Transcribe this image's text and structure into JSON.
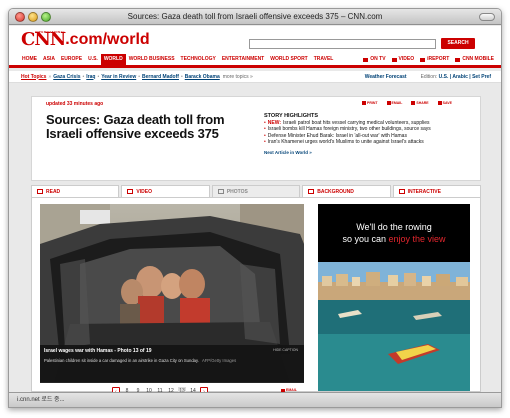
{
  "window": {
    "title": "Sources: Gaza death toll from Israeli offensive exceeds 375 – CNN.com"
  },
  "status_bar": {
    "text": "i.cnn.net 로드 중..."
  },
  "logo": {
    "main": "CNN",
    "edition": ".com/world",
    "intl": "INTERNATIONAL"
  },
  "search": {
    "button_label": "SEARCH"
  },
  "nav": {
    "items": [
      "HOME",
      "ASIA",
      "EUROPE",
      "U.S.",
      "WORLD",
      "WORLD BUSINESS",
      "TECHNOLOGY",
      "ENTERTAINMENT",
      "WORLD SPORT",
      "TRAVEL"
    ],
    "active": "WORLD",
    "right_items": [
      "ON TV",
      "VIDEO",
      "iREPORT",
      "CNN MOBILE"
    ]
  },
  "subnav": {
    "hot_topics_label": "Hot Topics",
    "topics": [
      "Gaza Crisis",
      "Iraq",
      "Year in Review",
      "Bernard Madoff",
      "Barack Obama"
    ],
    "more_label": "more topics »",
    "weather_label": "Weather Forecast",
    "edition_label": "Edition:",
    "editions": "U.S. | Arabic | Set Pref"
  },
  "story": {
    "updated": "updated 33 minutes ago",
    "share_items": [
      "PRINT",
      "EMAIL",
      "SHARE",
      "SAVE"
    ],
    "headline": "Sources: Gaza death toll from Israeli offensive exceeds 375",
    "highlights_title": "STORY HIGHLIGHTS",
    "new_badge": "NEW:",
    "highlights": [
      "Israeli patrol boat hits vessel carrying medical volunteers, supplies",
      "Israeli bombs kill Hamas foreign ministry, two other buildings, source says",
      "Defense Minister Ehud Barak: Israel in 'all-out war' with Hamas",
      "Iran's Khamenei urges world's Muslims to unite against Israel's attacks"
    ],
    "next_article": "Next Article in World »"
  },
  "tabs": {
    "read": "READ",
    "video": "VIDEO",
    "photos": "PHOTOS",
    "background": "BACKGROUND",
    "interactive": "INTERACTIVE"
  },
  "gallery": {
    "caption_title": "Israel wages war with Hamas - Photo 13 of 19",
    "caption_text": "Palestinian children sit inside a car damaged in an airstrike in Gaza City on Sunday.",
    "credit": "AFP/Getty Images",
    "enlarge_label": "HIDE CAPTION",
    "pages": [
      "8",
      "9",
      "10",
      "11",
      "12",
      "13",
      "14"
    ],
    "current_page": "13",
    "email_label": "EMAIL"
  },
  "ad": {
    "line1": "We'll do the rowing",
    "line2_prefix": "so you can",
    "line2_highlight": "enjoy the view"
  },
  "colors": {
    "brand_red": "#cc0000",
    "link_blue": "#004276"
  }
}
